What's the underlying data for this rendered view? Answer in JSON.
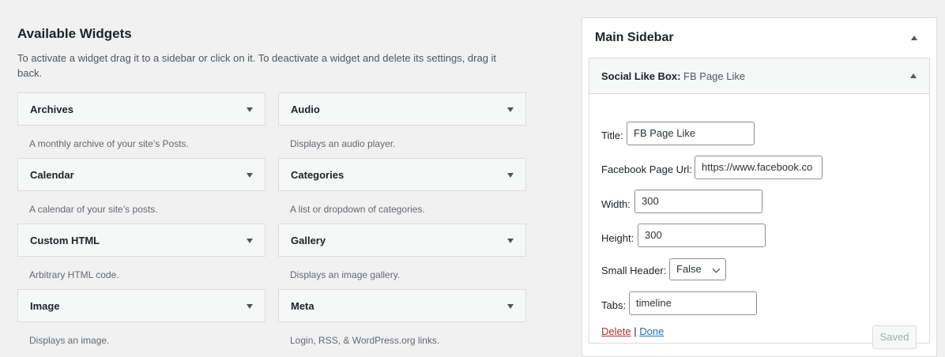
{
  "available": {
    "title": "Available Widgets",
    "description": "To activate a widget drag it to a sidebar or click on it. To deactivate a widget and delete its settings, drag it back.",
    "widgets": [
      {
        "name": "Archives",
        "desc": "A monthly archive of your site’s Posts."
      },
      {
        "name": "Audio",
        "desc": "Displays an audio player."
      },
      {
        "name": "Calendar",
        "desc": "A calendar of your site’s posts."
      },
      {
        "name": "Categories",
        "desc": "A list or dropdown of categories."
      },
      {
        "name": "Custom HTML",
        "desc": "Arbitrary HTML code."
      },
      {
        "name": "Gallery",
        "desc": "Displays an image gallery."
      },
      {
        "name": "Image",
        "desc": "Displays an image."
      },
      {
        "name": "Meta",
        "desc": "Login, RSS, & WordPress.org links."
      }
    ]
  },
  "sidebar": {
    "title": "Main Sidebar",
    "widget": {
      "name": "Social Like Box:",
      "instance_title": "FB Page Like",
      "fields": {
        "title_label": "Title:",
        "title_value": "FB Page Like",
        "url_label": "Facebook Page Url:",
        "url_value": "https://www.facebook.co",
        "width_label": "Width:",
        "width_value": "300",
        "height_label": "Height:",
        "height_value": "300",
        "small_header_label": "Small Header:",
        "small_header_value": "False",
        "tabs_label": "Tabs:",
        "tabs_value": "timeline"
      },
      "delete_label": "Delete",
      "separator": "|",
      "done_label": "Done",
      "saved_label": "Saved"
    }
  },
  "colors": {
    "background": "#f1f1f1",
    "delete": "#b32d2e",
    "link": "#2271b1"
  }
}
